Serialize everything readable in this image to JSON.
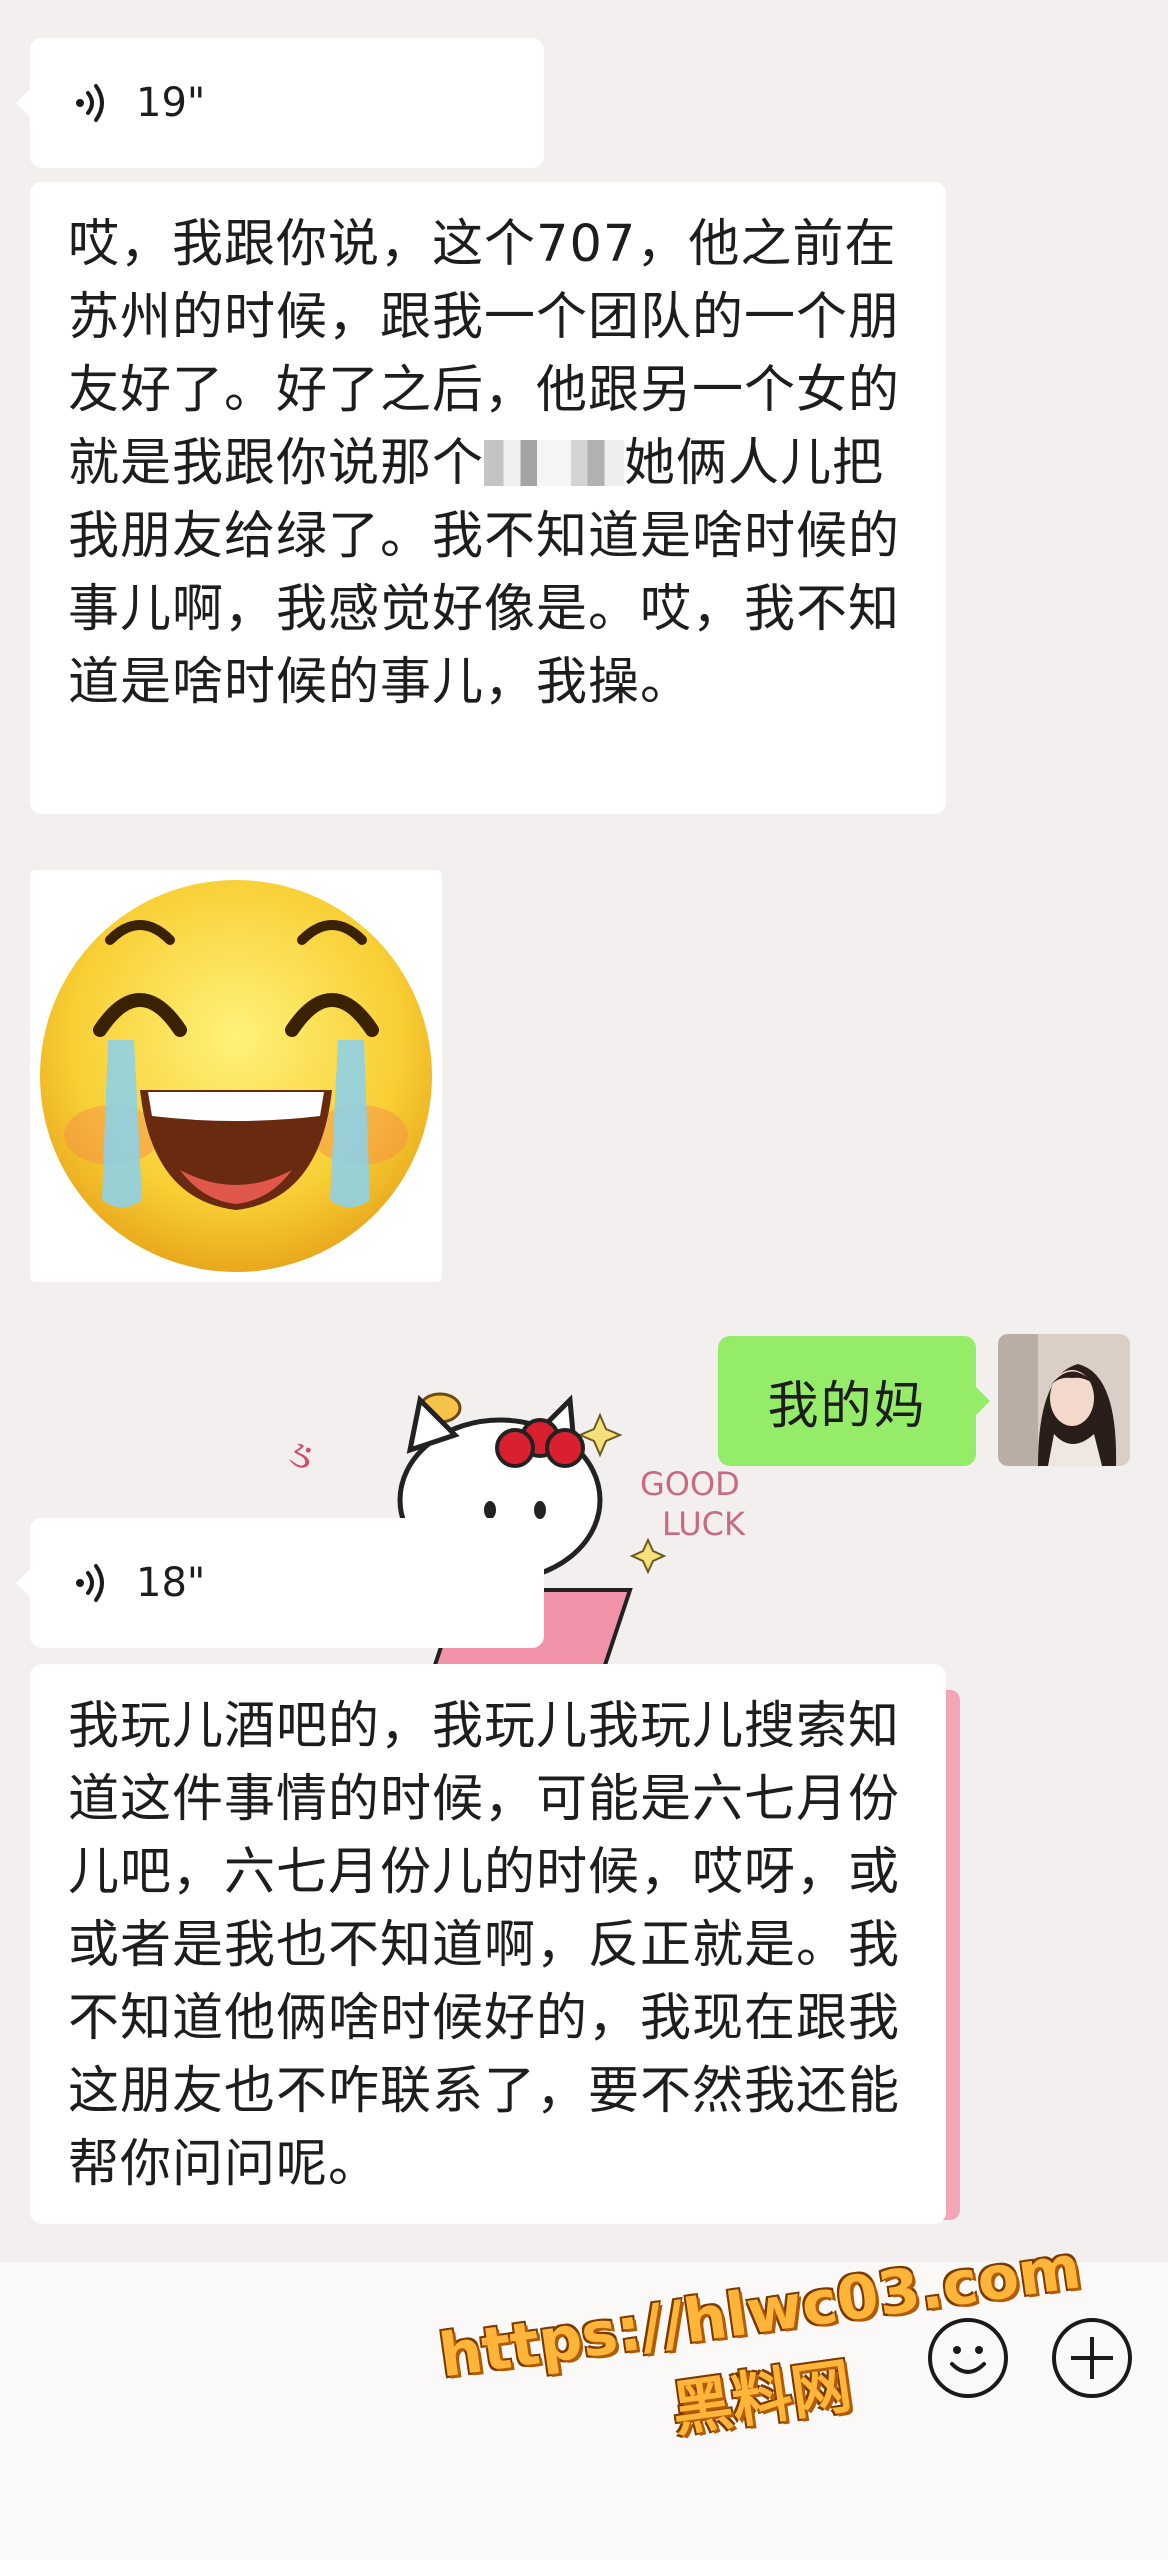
{
  "messages": {
    "voice1": {
      "duration": "19\""
    },
    "text1": {
      "before_censor": "哎，我跟你说，这个707，他之前在苏州的时候，跟我一个团队的一个朋友好了。好了之后，他跟另一个女的就是我跟你说那个",
      "after_censor": "她俩人儿把我朋友给绿了。我不知道是啥时候的事儿啊，我感觉好像是。哎，我不知道是啥时候的事儿，我操。"
    },
    "sticker": {
      "icon": "laughing-crying-emoji-icon"
    },
    "sent": {
      "text": "我的妈"
    },
    "voice2": {
      "duration": "18\""
    },
    "text2": {
      "text": "我玩儿酒吧的，我玩儿我玩儿搜索知道这件事情的时候，可能是六七月份儿吧，六七月份儿的时候，哎呀，或或者是我也不知道啊，反正就是。我不知道他俩啥时候好的，我现在跟我这朋友也不咋联系了，要不然我还能帮你问问呢。"
    }
  },
  "background_sticker": {
    "text1": "GOOD",
    "text2": "LUCK"
  },
  "watermark": {
    "url": "https://hlwc03.com",
    "name": "黑料网"
  },
  "toolbar": {
    "emoji_icon": "smiley-face-icon",
    "plus_icon": "plus-icon"
  },
  "colors": {
    "background": "#f4efef",
    "received_bubble": "#ffffff",
    "sent_bubble": "#95ec69",
    "watermark": "#ffb43a"
  }
}
